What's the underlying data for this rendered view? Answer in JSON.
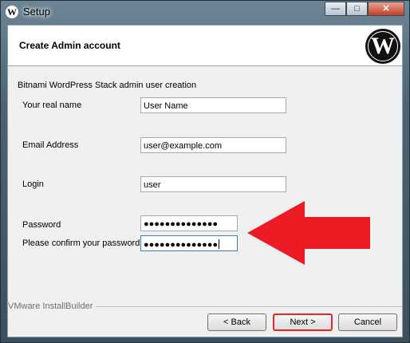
{
  "window": {
    "title": "Setup",
    "app_icon": "wordpress-icon"
  },
  "caption_buttons": {
    "minimize": "—",
    "maximize": "□",
    "close": "✕"
  },
  "header": {
    "title": "Create Admin account",
    "logo": "wordpress-logo"
  },
  "form": {
    "subtitle": "Bitnami WordPress Stack admin user creation",
    "real_name": {
      "label": "Your real name",
      "value": "User Name"
    },
    "email": {
      "label": "Email Address",
      "value": "user@example.com"
    },
    "login": {
      "label": "Login",
      "value": "user"
    },
    "password": {
      "label": "Password",
      "value": "●●●●●●●●●●●●●●"
    },
    "confirm_password": {
      "label": "Please confirm your password",
      "value": "●●●●●●●●●●●●●●"
    }
  },
  "annotation": {
    "arrow_color": "#ed1c24",
    "icon": "red-arrow-left"
  },
  "footer": {
    "brand": "VMware InstallBuilder"
  },
  "buttons": {
    "back": "< Back",
    "next": "Next >",
    "cancel": "Cancel"
  }
}
